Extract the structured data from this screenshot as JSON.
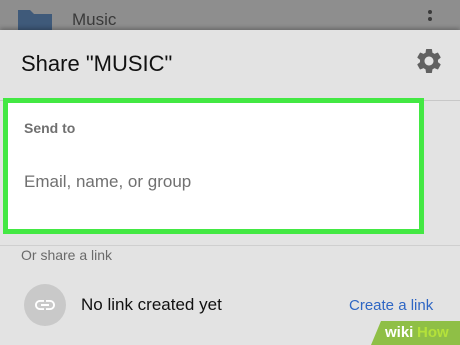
{
  "background": {
    "folder_name": "Music"
  },
  "share_dialog": {
    "title": "Share \"MUSIC\"",
    "settings_icon": "gear-icon",
    "send_to": {
      "label": "Send to",
      "placeholder": "Email, name, or group",
      "value": "",
      "highlight_color": "#43e843"
    },
    "link_section": {
      "label": "Or share a link",
      "link_icon": "link-icon",
      "status": "No link created yet",
      "create_label": "Create a link",
      "accent_color": "#2e66c4"
    }
  },
  "watermark": {
    "wiki": "wiki",
    "how": "How"
  }
}
